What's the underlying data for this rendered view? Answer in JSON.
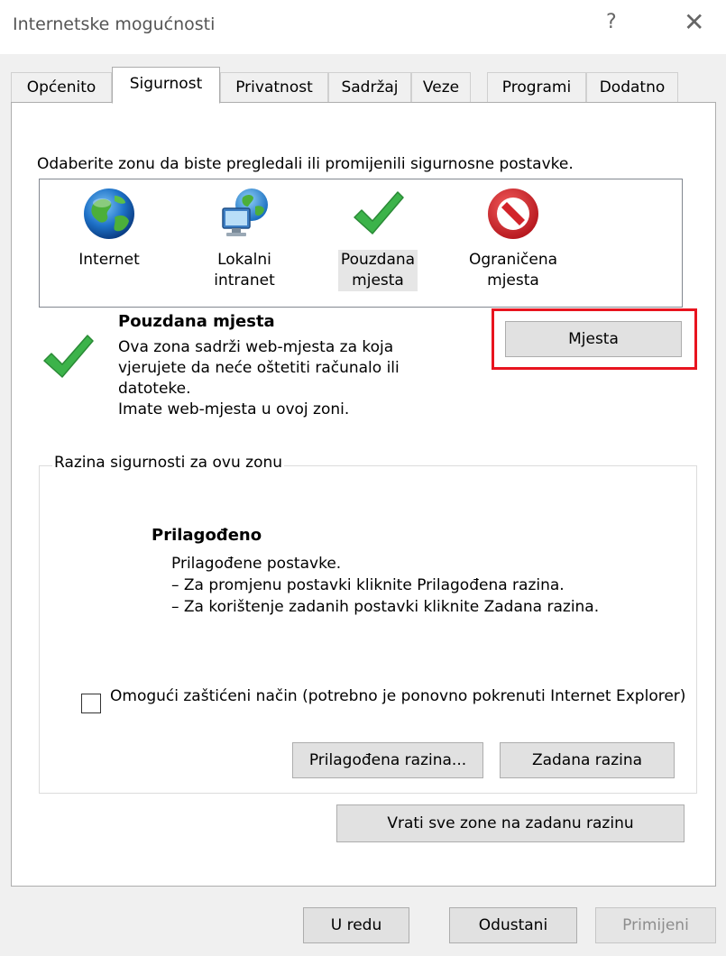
{
  "window": {
    "title": "Internetske mogućnosti",
    "help_glyph": "?",
    "close_glyph": "✕"
  },
  "tabs": [
    {
      "label": "Općenito"
    },
    {
      "label": "Sigurnost",
      "active": true
    },
    {
      "label": "Privatnost"
    },
    {
      "label": "Sadržaj"
    },
    {
      "label": "Veze"
    },
    {
      "label": "Programi"
    },
    {
      "label": "Dodatno"
    }
  ],
  "security": {
    "instruction": "Odaberite zonu da biste pregledali ili promijenili sigurnosne postavke.",
    "zones": [
      {
        "label": "Internet",
        "icon": "globe-icon"
      },
      {
        "label": "Lokalni\nintranet",
        "icon": "intranet-icon"
      },
      {
        "label": "Pouzdana\nmjesta",
        "icon": "checkmark-icon",
        "selected": true
      },
      {
        "label": "Ograničena\nmjesta",
        "icon": "restricted-icon"
      }
    ],
    "selected_zone": {
      "title": "Pouzdana mjesta",
      "description": "Ova zona sadrži web-mjesta za koja\nvjerujete da neće oštetiti računalo ili\ndatoteke.\nImate web-mjesta u ovoj zoni.",
      "sites_button": "Mjesta"
    },
    "level_group": {
      "legend": "Razina sigurnosti za ovu zonu",
      "level_title": "Prilagođeno",
      "level_desc": "Prilagođene postavke.\n– Za promjenu postavki kliknite Prilagođena razina.\n– Za korištenje zadanih postavki kliknite Zadana razina.",
      "protected_mode_label": "Omogući zaštićeni način (potrebno je ponovno pokrenuti Internet Explorer)",
      "protected_mode_checked": false,
      "custom_level_button": "Prilagođena razina...",
      "default_level_button": "Zadana razina"
    },
    "reset_all_button": "Vrati sve zone na zadanu razinu"
  },
  "footer": {
    "ok": "U redu",
    "cancel": "Odustani",
    "apply": "Primijeni"
  },
  "colors": {
    "highlight_border": "#e8141f",
    "check_green": "#3cb34a",
    "restricted_red": "#d2232a"
  }
}
